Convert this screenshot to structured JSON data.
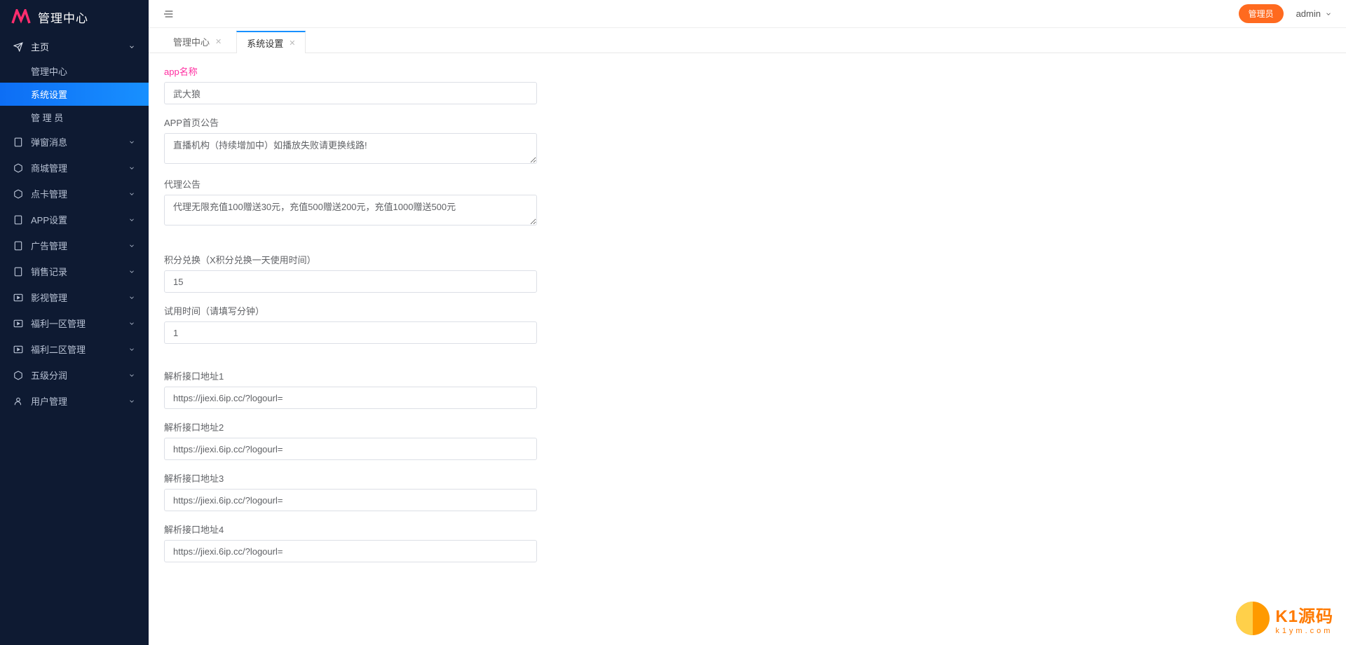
{
  "brand": {
    "title": "管理中心"
  },
  "topbar": {
    "badge": "管理员",
    "user": "admin"
  },
  "sidebar": {
    "main": {
      "label": "主页"
    },
    "sub": {
      "center": "管理中心",
      "settings": "系统设置",
      "admin": "管 理 员"
    },
    "items": [
      {
        "label": "弹窗消息"
      },
      {
        "label": "商城管理"
      },
      {
        "label": "点卡管理"
      },
      {
        "label": "APP设置"
      },
      {
        "label": "广告管理"
      },
      {
        "label": "销售记录"
      },
      {
        "label": "影视管理"
      },
      {
        "label": "福利一区管理"
      },
      {
        "label": "福利二区管理"
      },
      {
        "label": "五级分润"
      },
      {
        "label": "用户管理"
      }
    ]
  },
  "tabs": {
    "t0": "管理中心",
    "t1": "系统设置"
  },
  "form": {
    "app_name_label": "app名称",
    "app_name_value": "武大狼",
    "home_notice_label": "APP首页公告",
    "home_notice_value": "直播机构（持续增加中）如播放失败请更换线路!",
    "agent_notice_label": "代理公告",
    "agent_notice_value": "代理无限充值100赠送30元，充值500赠送200元，充值1000赠送500元",
    "points_label": "积分兑换（X积分兑换一天使用时间）",
    "points_value": "15",
    "trial_label": "试用时间（请填写分钟）",
    "trial_value": "1",
    "api1_label": "解析接口地址1",
    "api1_value": "https://jiexi.6ip.cc/?logourl=",
    "api2_label": "解析接口地址2",
    "api2_value": "https://jiexi.6ip.cc/?logourl=",
    "api3_label": "解析接口地址3",
    "api3_value": "https://jiexi.6ip.cc/?logourl=",
    "api4_label": "解析接口地址4",
    "api4_value": "https://jiexi.6ip.cc/?logourl="
  },
  "watermark": {
    "main": "K1源码",
    "sub": "k1ym.com"
  }
}
